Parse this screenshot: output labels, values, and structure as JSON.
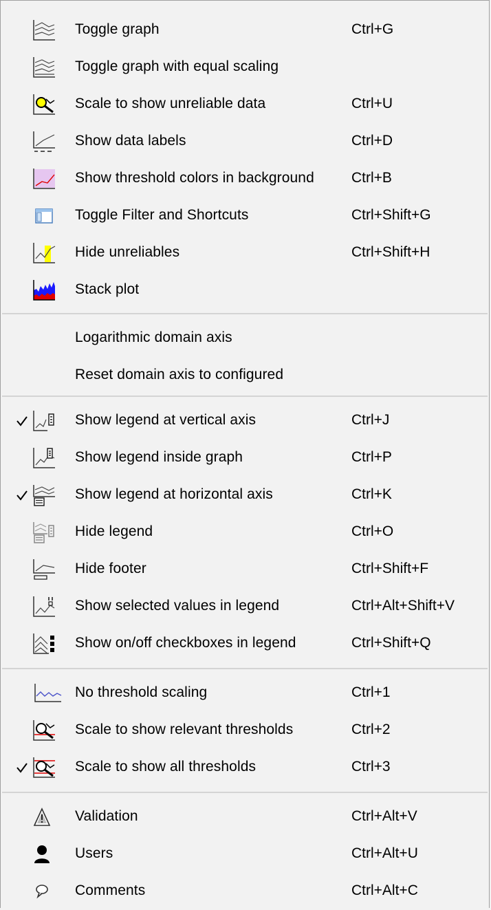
{
  "menu": {
    "items": [
      {
        "label": "Toggle graph",
        "shortcut": "Ctrl+G",
        "icon": "graph-toggle-icon",
        "checked": false
      },
      {
        "label": "Toggle graph with equal scaling",
        "shortcut": "",
        "icon": "graph-equal-scaling-icon",
        "checked": false
      },
      {
        "label": "Scale to show unreliable data",
        "shortcut": "Ctrl+U",
        "icon": "unreliable-scale-icon",
        "checked": false
      },
      {
        "label": "Show data labels",
        "shortcut": "Ctrl+D",
        "icon": "data-labels-icon",
        "checked": false
      },
      {
        "label": "Show threshold colors  in background",
        "shortcut": "Ctrl+B",
        "icon": "threshold-background-icon",
        "checked": false
      },
      {
        "label": "Toggle Filter and Shortcuts",
        "shortcut": "Ctrl+Shift+G",
        "icon": "filter-shortcuts-icon",
        "checked": false
      },
      {
        "label": "Hide unreliables",
        "shortcut": "Ctrl+Shift+H",
        "icon": "hide-unreliables-icon",
        "checked": false
      },
      {
        "label": "Stack plot",
        "shortcut": "",
        "icon": "stack-plot-icon",
        "checked": false
      },
      {
        "label": "Logarithmic domain axis",
        "shortcut": "",
        "icon": "",
        "checked": false
      },
      {
        "label": "Reset domain axis to configured",
        "shortcut": "",
        "icon": "",
        "checked": false
      },
      {
        "label": "Show legend at vertical axis",
        "shortcut": "Ctrl+J",
        "icon": "legend-vertical-icon",
        "checked": true
      },
      {
        "label": "Show legend inside graph",
        "shortcut": "Ctrl+P",
        "icon": "legend-inside-icon",
        "checked": false
      },
      {
        "label": "Show legend at horizontal axis",
        "shortcut": "Ctrl+K",
        "icon": "legend-horizontal-icon",
        "checked": true
      },
      {
        "label": "Hide legend",
        "shortcut": "Ctrl+O",
        "icon": "hide-legend-icon",
        "checked": false
      },
      {
        "label": "Hide footer",
        "shortcut": "Ctrl+Shift+F",
        "icon": "hide-footer-icon",
        "checked": false
      },
      {
        "label": "Show selected values in legend",
        "shortcut": "Ctrl+Alt+Shift+V",
        "icon": "selected-values-icon",
        "checked": false
      },
      {
        "label": "Show on/off checkboxes in legend",
        "shortcut": "Ctrl+Shift+Q",
        "icon": "legend-checkboxes-icon",
        "checked": false
      },
      {
        "label": "No threshold scaling",
        "shortcut": "Ctrl+1",
        "icon": "no-threshold-scaling-icon",
        "checked": false
      },
      {
        "label": "Scale to show relevant thresholds",
        "shortcut": "Ctrl+2",
        "icon": "relevant-thresholds-icon",
        "checked": false
      },
      {
        "label": "Scale to show all thresholds",
        "shortcut": "Ctrl+3",
        "icon": "all-thresholds-icon",
        "checked": true
      },
      {
        "label": "Validation",
        "shortcut": "Ctrl+Alt+V",
        "icon": "warning-triangle-icon",
        "checked": false
      },
      {
        "label": "Users",
        "shortcut": "Ctrl+Alt+U",
        "icon": "user-icon",
        "checked": false
      },
      {
        "label": "Comments",
        "shortcut": "Ctrl+Alt+C",
        "icon": "comment-bubble-icon",
        "checked": false
      }
    ]
  },
  "colors": {
    "background": "#f2f2f2",
    "separator": "#d4d4d4",
    "threshold_red": "#e00000",
    "unreliable_yellow": "#ffff00",
    "stack_blue": "#1a1aff"
  }
}
